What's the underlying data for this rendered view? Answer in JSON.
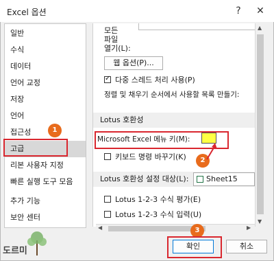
{
  "window": {
    "title": "Excel 옵션",
    "help_glyph": "?",
    "close_glyph": "✕"
  },
  "sidebar": {
    "items": [
      {
        "label": "일반"
      },
      {
        "label": "수식"
      },
      {
        "label": "데이터"
      },
      {
        "label": "언어 교정"
      },
      {
        "label": "저장"
      },
      {
        "label": "언어"
      },
      {
        "label": "접근성"
      },
      {
        "label": "고급"
      },
      {
        "label": "리본 사용자 지정"
      },
      {
        "label": "빠른 실행 도구 모음"
      },
      {
        "label": "추가 기능"
      },
      {
        "label": "보안 센터"
      }
    ],
    "selected": "고급"
  },
  "panel": {
    "open_lines": [
      "모든",
      "파일",
      "열기(L):"
    ],
    "web_options_button": "웹 옵션(P)...",
    "multi_thread_check": "다중 스레드 처리 사용(P)",
    "sort_list_label": "정렬 및 채우기 순서에서 사용할 목록 만들기:",
    "lotus_compat_header": "Lotus 호환성",
    "ms_excel_menu_key_label": "Microsoft Excel 메뉴 키(M):",
    "keyboard_nav_check": "키보드 명령 바꾸기(K)",
    "lotus_settings_header": "Lotus 호환성 설정 대상(L):",
    "sheet_select": "Sheet15",
    "lotus_formula_eval": "Lotus 1-2-3 수식 평가(E)",
    "lotus_formula_entry": "Lotus 1-2-3 수식 입력(U)"
  },
  "footer": {
    "ok": "확인",
    "cancel": "취소"
  },
  "annotations": {
    "step1": "1",
    "step2": "2",
    "step3": "3"
  },
  "watermark": {
    "text": "도르미"
  },
  "colors": {
    "highlight_red": "#d9262e",
    "badge_orange": "#e86b1c",
    "menu_key_yellow": "#ffff44"
  },
  "multi_thread_checked": true
}
